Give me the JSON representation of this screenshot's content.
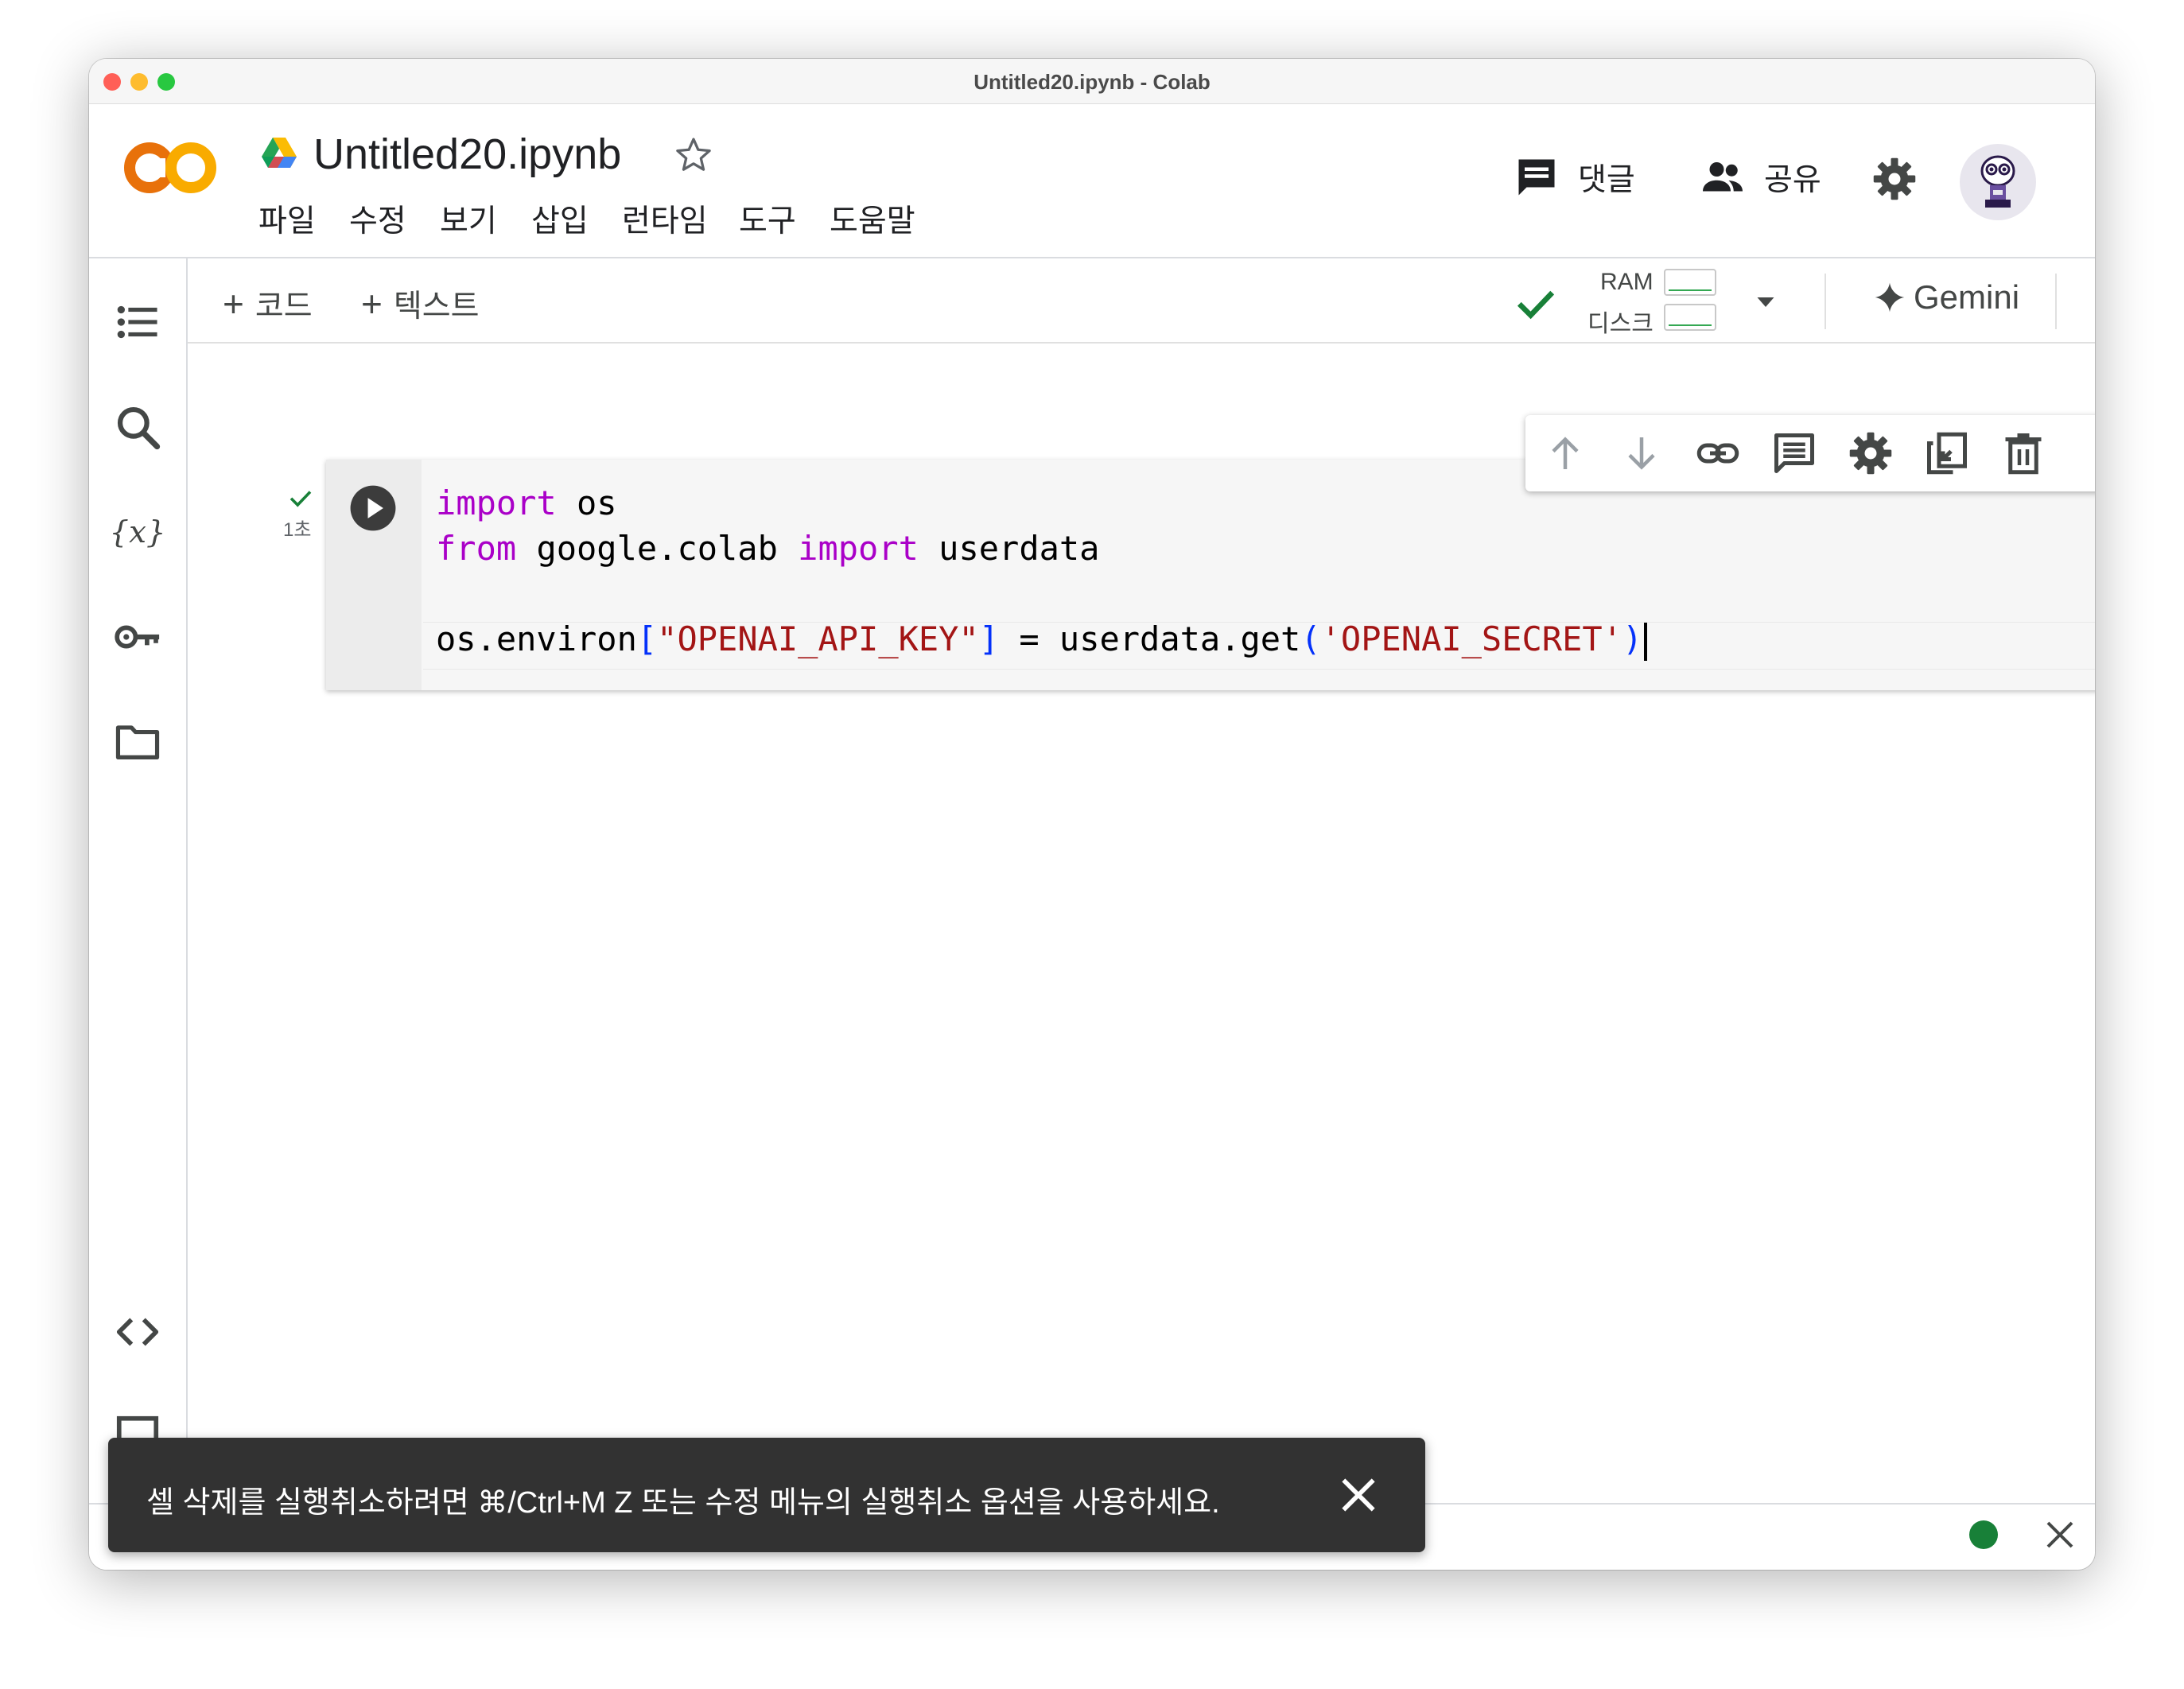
{
  "window": {
    "title": "Untitled20.ipynb - Colab"
  },
  "header": {
    "logo_text": "CO",
    "document_title": "Untitled20.ipynb",
    "menu": [
      "파일",
      "수정",
      "보기",
      "삽입",
      "런타임",
      "도구",
      "도움말"
    ],
    "comment_label": "댓글",
    "share_label": "공유"
  },
  "toolbar": {
    "add_code_label": "코드",
    "add_text_label": "텍스트",
    "ram_label": "RAM",
    "disk_label": "디스크",
    "gemini_label": "Gemini"
  },
  "cell": {
    "exec_time": "1초",
    "code_lines": [
      "import os",
      "from google.colab import userdata",
      "",
      "os.environ[\"OPENAI_API_KEY\"] = userdata.get('OPENAI_SECRET')"
    ],
    "tokens": {
      "kw_import": "import",
      "os": " os",
      "kw_from": "from",
      "google_colab": " google.colab ",
      "kw_import2": "import",
      "userdata": " userdata",
      "os_environ": "os.environ",
      "lbr": "[",
      "key_str": "\"OPENAI_API_KEY\"",
      "rbr": "]",
      "assign": " = userdata.get",
      "lpar": "(",
      "secret_str": "'OPENAI_SECRET'",
      "rpar": ")"
    }
  },
  "snackbar": {
    "message": "셀 삭제를 실행취소하려면 ⌘/Ctrl+M Z 또는 수정 메뉴의 실행취소 옵션을 사용하세요."
  },
  "colors": {
    "keyword": "#aa00c8",
    "string": "#a31515",
    "bracket": "#0431fa",
    "status_ok": "#188038",
    "logo_orange": "#f9ab00",
    "logo_dark_orange": "#e8710a"
  }
}
